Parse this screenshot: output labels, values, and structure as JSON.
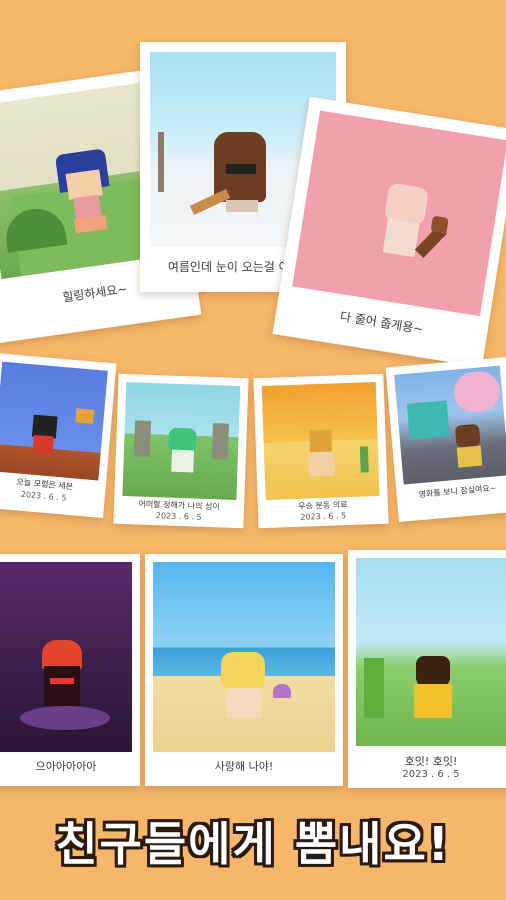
{
  "tagline": "친구들에게 뽐내요!",
  "cards": [
    {
      "caption": "힐링하세요~",
      "date": ""
    },
    {
      "caption": "여름인데 눈이 오는걸 어떡해?",
      "date": ""
    },
    {
      "caption": "다 줄어 줍게용~",
      "date": ""
    },
    {
      "caption": "오늘 모험은 세븐",
      "date": "2023 . 6 . 5"
    },
    {
      "caption": "어떠할 정해가 나의 섬이",
      "date": "2023 . 6 . 5"
    },
    {
      "caption": "우승 분동 의료",
      "date": "2023 . 6 . 5"
    },
    {
      "caption": "영화를 보니 잠실여요~",
      "date": ""
    },
    {
      "caption": "으아아아아아",
      "date": ""
    },
    {
      "caption": "사랑해 나야!",
      "date": ""
    },
    {
      "caption": "호잇! 호잇!",
      "date": "2023 . 6 . 5"
    }
  ],
  "colors": {
    "background": "#f6b76a",
    "tagline_fill": "#ffffff",
    "tagline_outline": "#2a1a10"
  }
}
